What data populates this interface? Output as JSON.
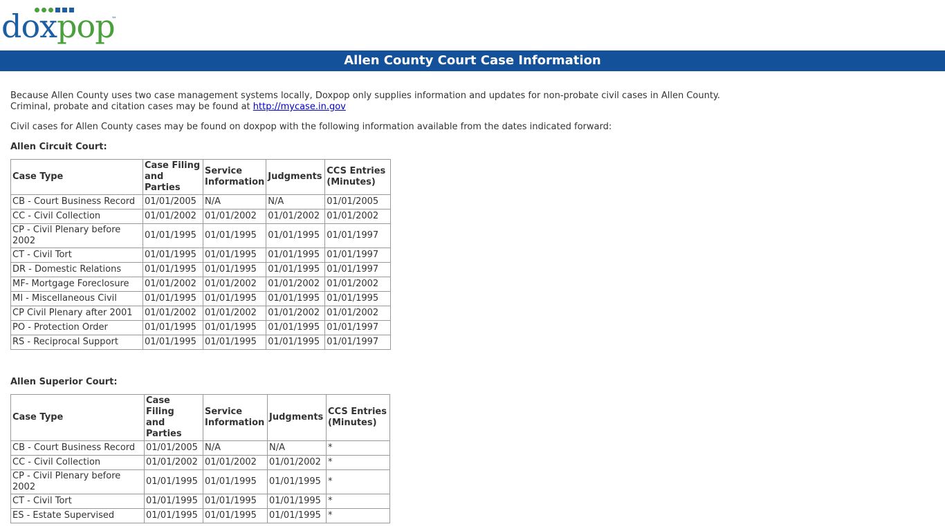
{
  "logo": {
    "part1": "dox",
    "part2": "pop",
    "tm": "™"
  },
  "title_bar": "Allen County Court Case Information",
  "intro": {
    "line1": "Because Allen County uses two case management systems locally, Doxpop only supplies information and updates for non-probate civil cases in Allen County.",
    "line2_prefix": "Criminal, probate and citation cases may be found at ",
    "link_text": "http://mycase.in.gov",
    "line3": "Civil cases for Allen County cases may be found on doxpop with the following information available from the dates indicated forward:"
  },
  "headers": {
    "case_type": "Case Type",
    "filing_l1": "Case Filing",
    "filing_l2": "and",
    "filing_l3": "Parties",
    "service_l1": "Service",
    "service_l2": "Information",
    "judgments": "Judgments",
    "ccs_l1": "CCS Entries",
    "ccs_l2": "(Minutes)"
  },
  "circuit": {
    "title": "Allen Circuit Court:",
    "rows": [
      [
        "CB - Court Business Record",
        "01/01/2005",
        "N/A",
        "N/A",
        "01/01/2005"
      ],
      [
        "CC - Civil Collection",
        "01/01/2002",
        "01/01/2002",
        "01/01/2002",
        "01/01/2002"
      ],
      [
        "CP - Civil Plenary before 2002",
        "01/01/1995",
        "01/01/1995",
        "01/01/1995",
        "01/01/1997"
      ],
      [
        "CT - Civil Tort",
        "01/01/1995",
        "01/01/1995",
        "01/01/1995",
        "01/01/1997"
      ],
      [
        "DR - Domestic Relations",
        "01/01/1995",
        "01/01/1995",
        "01/01/1995",
        "01/01/1997"
      ],
      [
        "MF- Mortgage Foreclosure",
        "01/01/2002",
        "01/01/2002",
        "01/01/2002",
        "01/01/2002"
      ],
      [
        "MI - Miscellaneous Civil",
        "01/01/1995",
        "01/01/1995",
        "01/01/1995",
        "01/01/1995"
      ],
      [
        "CP Civil Plenary after 2001",
        "01/01/2002",
        "01/01/2002",
        "01/01/2002",
        "01/01/2002"
      ],
      [
        "PO - Protection Order",
        "01/01/1995",
        "01/01/1995",
        "01/01/1995",
        "01/01/1997"
      ],
      [
        "RS - Reciprocal Support",
        "01/01/1995",
        "01/01/1995",
        "01/01/1995",
        "01/01/1997"
      ]
    ]
  },
  "superior": {
    "title": "Allen Superior Court:",
    "rows": [
      [
        "CB - Court Business Record",
        "01/01/2005",
        "N/A",
        "N/A",
        "*"
      ],
      [
        "CC - Civil Collection",
        "01/01/2002",
        "01/01/2002",
        "01/01/2002",
        "*"
      ],
      [
        "CP - Civil Plenary before 2002",
        "01/01/1995",
        "01/01/1995",
        "01/01/1995",
        "*"
      ],
      [
        "CT - Civil Tort",
        "01/01/1995",
        "01/01/1995",
        "01/01/1995",
        "*"
      ],
      [
        "ES - Estate Supervised",
        "01/01/1995",
        "01/01/1995",
        "01/01/1995",
        "*"
      ]
    ]
  },
  "colors": {
    "brand_blue": "#14519b",
    "logo_blue": "#1d5fa3",
    "logo_green": "#4aa03c"
  }
}
